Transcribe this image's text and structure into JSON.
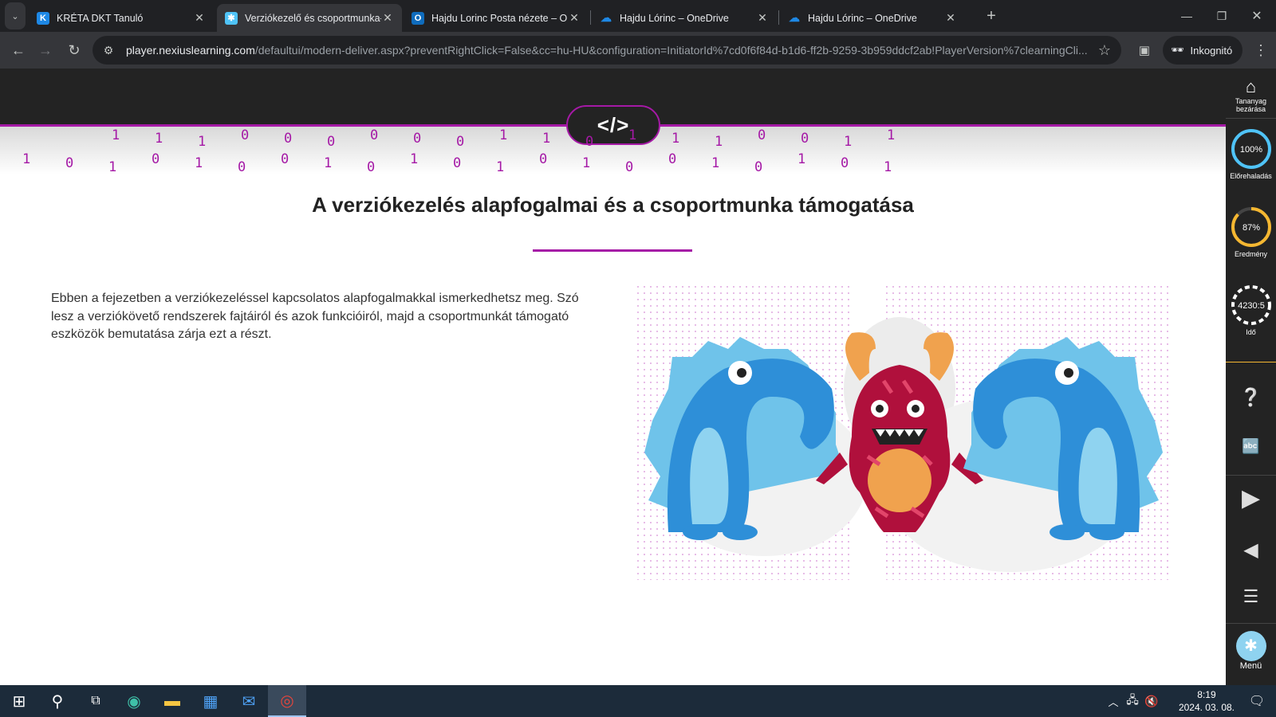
{
  "browser": {
    "tabs": [
      {
        "title": "KRÉTA DKT Tanuló",
        "icon": "kreta-icon",
        "color": "#1e88e5",
        "active": false
      },
      {
        "title": "Verziókezelő és csoportmunka-",
        "icon": "nexius-icon",
        "color": "#4fc3f7",
        "active": true
      },
      {
        "title": "Hajdu Lorinc Posta nézete – Ou",
        "icon": "outlook-icon",
        "color": "#0f6cbd",
        "active": false
      },
      {
        "title": "Hajdu Lórinc – OneDrive",
        "icon": "onedrive-icon",
        "color": "#1e88e5",
        "active": false
      },
      {
        "title": "Hajdu Lórinc – OneDrive",
        "icon": "onedrive-icon",
        "color": "#1e88e5",
        "active": false
      }
    ],
    "url_host": "player.nexiuslearning.com",
    "url_path": "/defaultui/modern-deliver.aspx?preventRightClick=False&cc=hu-HU&configuration=InitiatorId%7cd0f6f84d-b1d6-ff2b-9259-3b959ddcf2ab!PlayerVersion%7clearningCli...",
    "incognito_label": "Inkognitó"
  },
  "page": {
    "badge": "</>",
    "binary_top": [
      "1",
      "1",
      "1",
      "0",
      "0",
      "0",
      "0",
      "0",
      "0",
      "1",
      "1",
      "0",
      "1",
      "1",
      "1",
      "0",
      "0",
      "1",
      "1"
    ],
    "binary_bottom": [
      "1",
      "0",
      "1",
      "0",
      "1",
      "0",
      "0",
      "1",
      "0",
      "1",
      "0",
      "1",
      "0",
      "1",
      "0",
      "0",
      "1",
      "0",
      "1",
      "0",
      "1"
    ],
    "heading": "A verziókezelés alapfogalmai és a csoportmunka támogatása",
    "body": "Ebben a fejezetben a verziókezeléssel kapcsolatos alapfogalmakkal ismerkedhetsz meg. Szó lesz a verziókövető rendszerek fajtáiról és azok funkcióiról, majd a csoportmunkát támogató eszközök bemutatása zárja ezt a részt."
  },
  "sidebar": {
    "home_label": "Tananyag bezárása",
    "progress_value": "100%",
    "progress_label": "Előrehaladás",
    "progress_fraction": 1.0,
    "result_value": "87%",
    "result_label": "Eredmény",
    "result_fraction": 0.87,
    "time_value": "4230:5",
    "time_label": "Idő",
    "menu_label": "Menü",
    "accent": "#f5b731"
  },
  "taskbar": {
    "time": "8:19",
    "date": "2024. 03. 08."
  }
}
